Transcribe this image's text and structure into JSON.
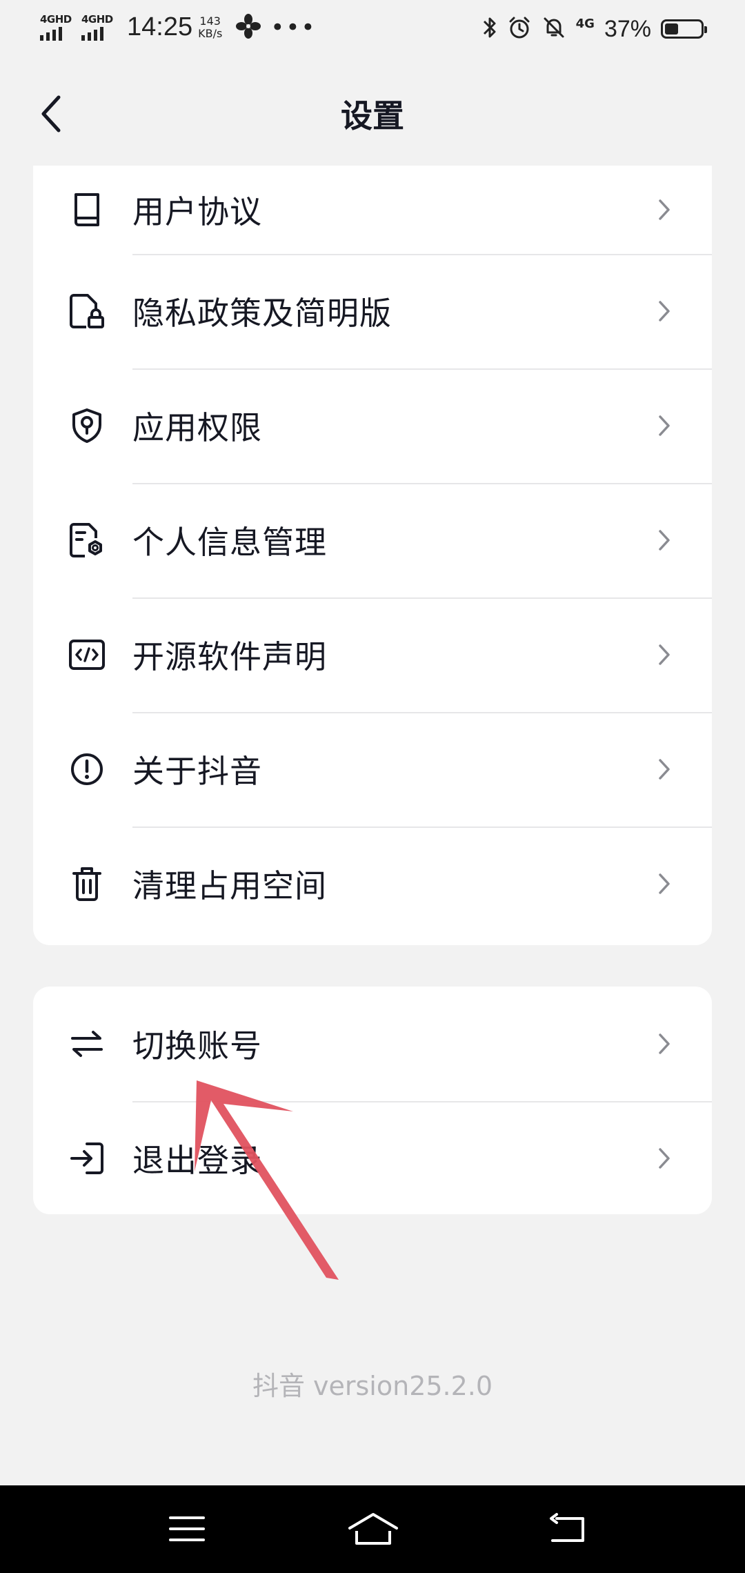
{
  "status_bar": {
    "sim1_label": "4GHD",
    "sim2_label": "4GHD",
    "time": "14:25",
    "speed_value": "143",
    "speed_unit": "KB/s",
    "more": "•••",
    "network_label": "4G",
    "battery_text": "37%",
    "battery_level": 0.37
  },
  "header": {
    "title": "设置"
  },
  "menu_group_1": {
    "items": [
      {
        "label": "用户协议",
        "icon": "book-icon"
      },
      {
        "label": "隐私政策及简明版",
        "icon": "document-lock-icon"
      },
      {
        "label": "应用权限",
        "icon": "shield-key-icon"
      },
      {
        "label": "个人信息管理",
        "icon": "document-gear-icon"
      },
      {
        "label": "开源软件声明",
        "icon": "code-icon"
      },
      {
        "label": "关于抖音",
        "icon": "info-circle-icon"
      },
      {
        "label": "清理占用空间",
        "icon": "trash-icon"
      }
    ]
  },
  "menu_group_2": {
    "items": [
      {
        "label": "切换账号",
        "icon": "swap-icon"
      },
      {
        "label": "退出登录",
        "icon": "logout-icon"
      }
    ]
  },
  "footer": {
    "version": "抖音 version25.2.0"
  },
  "colors": {
    "background": "#f2f2f2",
    "card": "#ffffff",
    "text": "#161823",
    "divider": "#e6e6e8",
    "version_text": "#b4b4b8",
    "annotation_arrow": "#e0525f"
  }
}
